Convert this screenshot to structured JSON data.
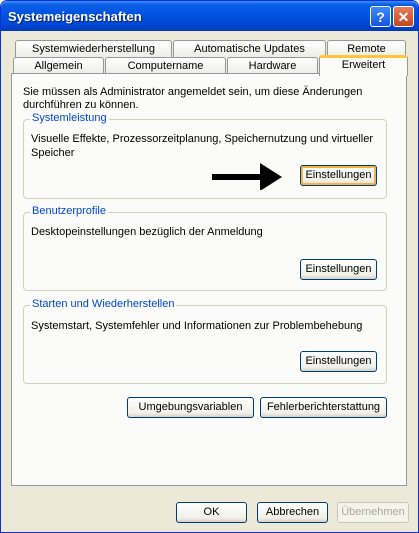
{
  "window": {
    "title": "Systemeigenschaften",
    "help_label": "?",
    "close_label": "✕"
  },
  "tabs": {
    "row1": [
      "Systemwiederherstellung",
      "Automatische Updates",
      "Remote"
    ],
    "row2": [
      "Allgemein",
      "Computername",
      "Hardware",
      "Erweitert"
    ],
    "active": "Erweitert"
  },
  "info_text": [
    "Sie müssen als Administrator angemeldet sein, um diese Änderungen",
    "durchführen zu können."
  ],
  "groups": {
    "performance": {
      "title": "Systemleistung",
      "text": [
        "Visuelle Effekte, Prozessorzeitplanung, Speichernutzung und virtueller",
        "Speicher"
      ],
      "button": "Einstellungen"
    },
    "profiles": {
      "title": "Benutzerprofile",
      "text": "Desktopeinstellungen bezüglich der Anmeldung",
      "button": "Einstellungen"
    },
    "startup": {
      "title": "Starten und Wiederherstellen",
      "text": "Systemstart, Systemfehler und Informationen zur Problembehebung",
      "button": "Einstellungen"
    }
  },
  "buttons": {
    "env_vars": "Umgebungsvariablen",
    "error_report": "Fehlerberichterstattung",
    "ok": "OK",
    "cancel": "Abbrechen",
    "apply": "Übernehmen"
  },
  "annotation_icon": "right-arrow-icon"
}
